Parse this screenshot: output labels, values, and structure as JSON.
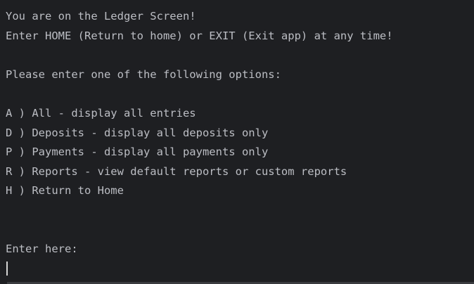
{
  "header": {
    "title_line": "You are on the Ledger Screen!",
    "hint_line": "Enter HOME (Return to home) or EXIT (Exit app) at any time!"
  },
  "prompt": {
    "instruction": "Please enter one of the following options:"
  },
  "options": [
    {
      "text": "A ) All - display all entries"
    },
    {
      "text": "D ) Deposits - display all deposits only"
    },
    {
      "text": "P ) Payments - display all payments only"
    },
    {
      "text": "R ) Reports - view default reports or custom reports"
    },
    {
      "text": "H ) Return to Home"
    }
  ],
  "input": {
    "label": "Enter here:",
    "value": ""
  }
}
